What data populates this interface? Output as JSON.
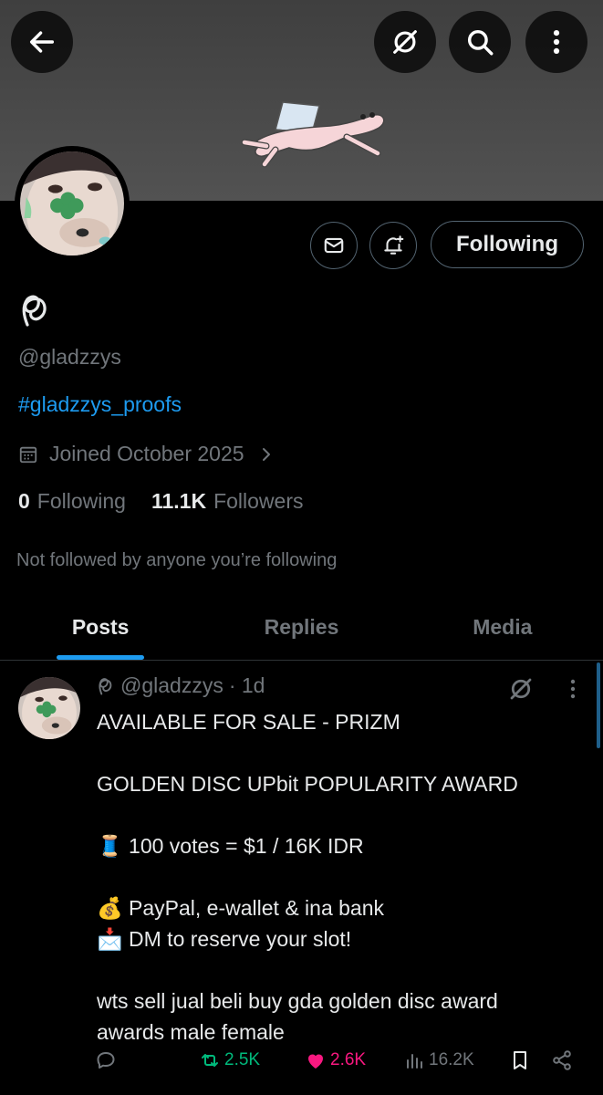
{
  "profile": {
    "handle": "@gladzzys",
    "hashtag": "#gladzzys_proofs",
    "joined": "Joined October 2025",
    "following_count": "0",
    "following_label": "Following",
    "followers_count": "11.1K",
    "followers_label": "Followers",
    "not_followed": "Not followed by anyone you’re following",
    "follow_button": "Following"
  },
  "tabs": [
    {
      "label": "Posts",
      "active": true
    },
    {
      "label": "Replies",
      "active": false
    },
    {
      "label": "Media",
      "active": false
    }
  ],
  "post": {
    "handle": "@gladzzys",
    "age": "· 1d",
    "lines": [
      "AVAILABLE FOR SALE - PRIZM",
      "",
      "GOLDEN DISC UPbit POPULARITY AWARD",
      "",
      "🧵 100 votes = $1 / 16K IDR",
      "",
      "💰 PayPal, e-wallet & ina bank",
      "📩 DM to reserve your slot!",
      "",
      "wts sell jual beli buy gda golden disc award",
      "awards male female"
    ],
    "retweets": "2.5K",
    "likes": "2.6K",
    "views": "16.2K"
  },
  "colors": {
    "accent": "#1d9bf0",
    "retweet": "#00ba7c",
    "like": "#f91880",
    "muted": "#71767b",
    "border": "#2f3336"
  },
  "icons": [
    "back-arrow-icon",
    "grok-icon",
    "search-icon",
    "more-vertical-icon",
    "mail-icon",
    "bell-plus-icon",
    "calendar-icon",
    "chevron-right-icon",
    "reply-icon",
    "retweet-icon",
    "heart-icon",
    "views-icon",
    "bookmark-icon",
    "share-icon"
  ]
}
